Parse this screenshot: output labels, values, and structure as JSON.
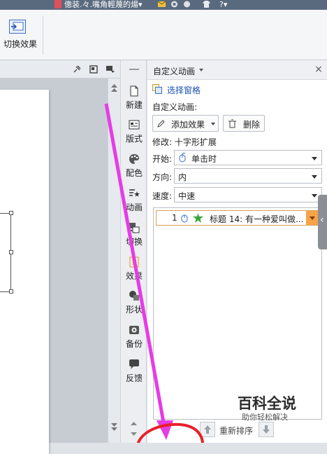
{
  "titlebar": {
    "document_title": "傯装.々.嘴角輕蔑的煬▾",
    "icons": [
      "app-logo-icon",
      "mail-icon",
      "skin-icon",
      "cloud-icon",
      "shirt-icon",
      "help-icon"
    ],
    "help_label": "?▾"
  },
  "ribbon": {
    "transition_button_label": "切换效果",
    "transition_icon": "transition-icon"
  },
  "sidebar": {
    "items": [
      {
        "label": "新建",
        "icon": "new-icon"
      },
      {
        "label": "版式",
        "icon": "layout-icon"
      },
      {
        "label": "配色",
        "icon": "palette-icon"
      },
      {
        "label": "动画",
        "icon": "animation-icon"
      },
      {
        "label": "切换",
        "icon": "switch-icon"
      },
      {
        "label": "效果",
        "icon": "effect-icon"
      },
      {
        "label": "形状",
        "icon": "shape-icon"
      },
      {
        "label": "备份",
        "icon": "backup-icon"
      },
      {
        "label": "反馈",
        "icon": "feedback-icon"
      }
    ]
  },
  "pane": {
    "title": "自定义动画",
    "select_window_link": "选择窗格",
    "section_label": "自定义动画:",
    "add_effect_label": "添加效果",
    "delete_label": "删除",
    "modify_label": "修改: 十字形扩展",
    "start_label": "开始:",
    "start_value": "单击时",
    "direction_label": "方向:",
    "direction_value": "内",
    "speed_label": "速度:",
    "speed_value": "中速",
    "animation_items": [
      {
        "number": "1",
        "text": "标题 14: 有一种爱叫做..."
      }
    ],
    "reorder_label": "重新排序"
  },
  "watermark": {
    "main": "百科全说",
    "sub": "助你轻松解决"
  },
  "colors": {
    "annotation_arrow": "#e63ce6",
    "annotation_circle": "#e8202a",
    "selected_item_accent": "#f7a34a",
    "link": "#1a4fb0"
  }
}
